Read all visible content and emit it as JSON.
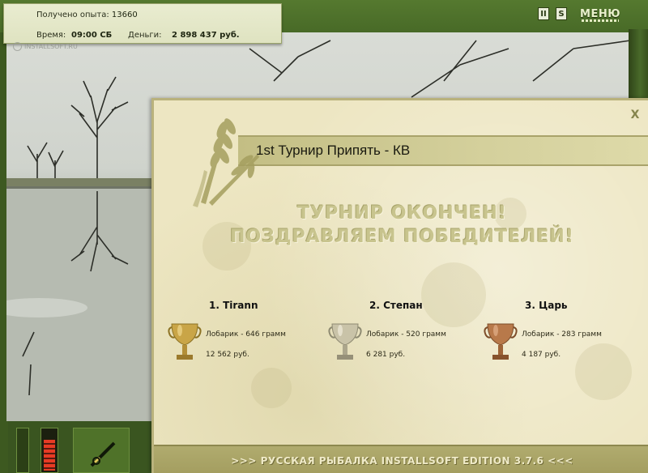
{
  "status": {
    "experience_label": "Получено опыта:",
    "experience_value": "13660",
    "time_label": "Время:",
    "time_value": "09:00 СБ",
    "money_label": "Деньги:",
    "money_value": "2 898 437 руб."
  },
  "watermark": "INSTALLSOFT.RU",
  "controls": {
    "pause_label": "II",
    "speed_label": "S",
    "menu_label": "МЕНЮ"
  },
  "dialog": {
    "close_label": "X",
    "title": "1st Турнир Припять - КВ",
    "headline_1": "ТУРНИР ОКОНЧЕН!",
    "headline_2": "ПОЗДРАВЛЯЕМ ПОБЕДИТЕЛЕЙ!",
    "winners": [
      {
        "place": "1. Tirann",
        "catch": "Лобарик - 646 грамм",
        "prize": "12 562 руб.",
        "cup": "gold"
      },
      {
        "place": "2. Степан",
        "catch": "Лобарик - 520 грамм",
        "prize": "6 281 руб.",
        "cup": "silver"
      },
      {
        "place": "3. Царь",
        "catch": "Лобарик - 283 грамм",
        "prize": "4 187 руб.",
        "cup": "bronze"
      }
    ],
    "footer": ">>> РУССКАЯ РЫБАЛКА INSTALLSOFT EDITION 3.7.6 <<<"
  },
  "colors": {
    "gold": "#c9a547",
    "silver": "#c9c3a8",
    "bronze": "#b8794a"
  }
}
